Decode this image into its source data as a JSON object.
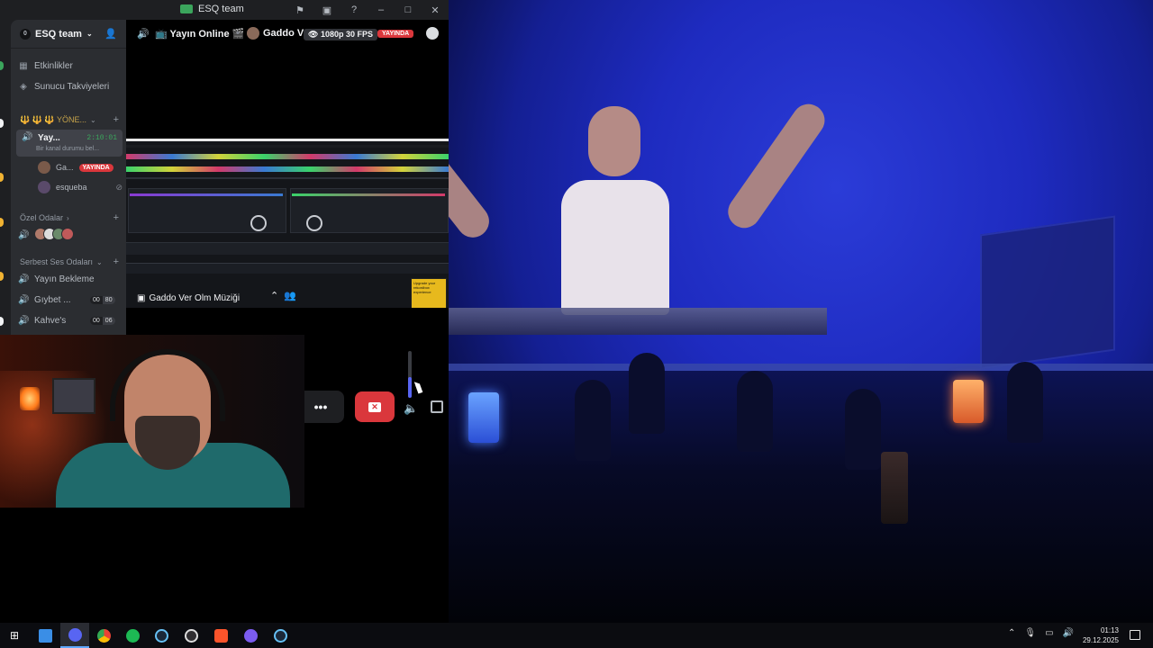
{
  "window": {
    "title": "ESQ team",
    "controls": [
      "flag-icon",
      "screen-icon",
      "help-icon",
      "minimize",
      "maximize",
      "close"
    ]
  },
  "server": {
    "badge": "0",
    "name": "ESQ team",
    "events_label": "Etkinlikler",
    "boosts_label": "Sunucu Takviyeleri"
  },
  "categories": {
    "management": "🔱 🔱 🔱 YÖNE...",
    "private_rooms": "Özel Odalar",
    "free_voice": "Serbest Ses Odaları"
  },
  "active_channel": {
    "name": "Yay...",
    "timer": "2:10:01",
    "status": "Bir kanal durumu bel..."
  },
  "voice_users": [
    {
      "name": "Ga...",
      "live": "YAYINDA"
    },
    {
      "name": "esqueba"
    }
  ],
  "voice_channels": [
    {
      "name": "Yayın Bekleme"
    },
    {
      "name": "Gıybet ...",
      "count_a": "00",
      "count_b": "80"
    },
    {
      "name": "Kahve's",
      "count_a": "00",
      "count_b": "06"
    }
  ],
  "stream": {
    "title": "📺 Yayın Online 🎬",
    "separator": "•",
    "user": "Gaddo Ve",
    "quality": "1080p 30 FPS",
    "live": "YAYINDA",
    "screen_label": "Gaddo Ver Olm Müziği",
    "ad_text": "Upgrade your rekordbox experience",
    "more_label": "•••"
  },
  "volume": {
    "level": 0.45
  },
  "taskbar": {
    "apps": [
      "windows",
      "explorer",
      "discord",
      "chrome",
      "spotify",
      "steam",
      "obs",
      "brave",
      "app-purple",
      "steam-2"
    ],
    "time": "01:13",
    "date": "29.12.2025"
  },
  "colors": {
    "accent": "#5865f2",
    "live": "#da373c",
    "online": "#3ba55c"
  }
}
